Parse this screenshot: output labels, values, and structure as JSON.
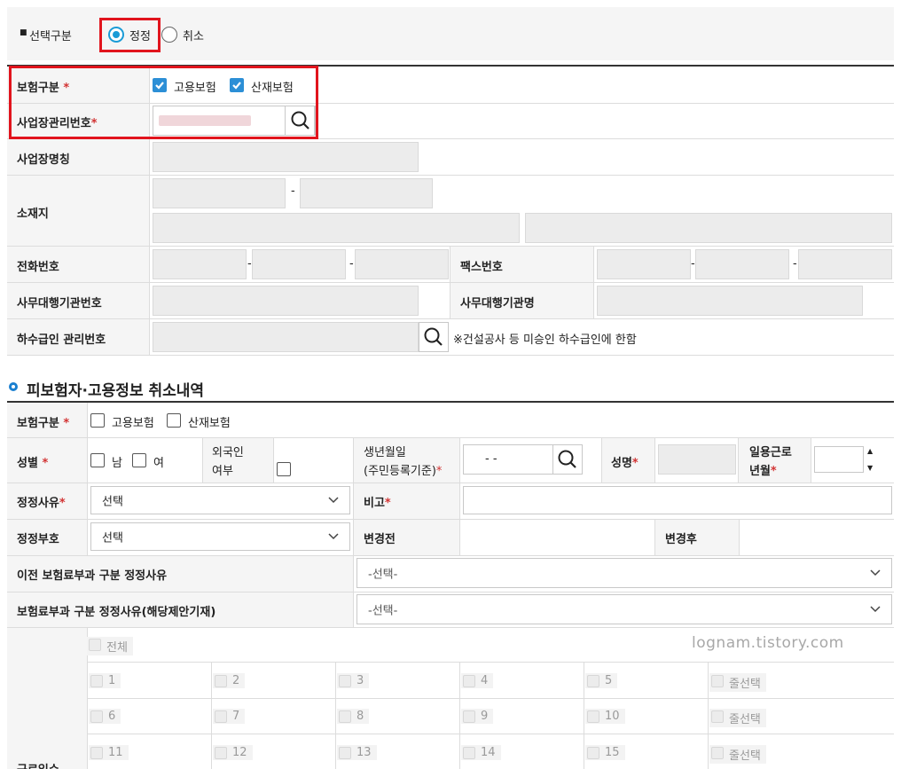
{
  "top": {
    "select_label": "선택구분",
    "radio_correct": "정정",
    "radio_cancel": "취소"
  },
  "section1": {
    "insurance_type_label": "보험구분",
    "employment_insurance": "고용보험",
    "industrial_insurance": "산재보험",
    "workplace_no_label": "사업장관리번호",
    "workplace_name_label": "사업장명칭",
    "location_label": "소재지",
    "phone_label": "전화번호",
    "fax_label": "팩스번호",
    "agency_no_label": "사무대행기관번호",
    "agency_name_label": "사무대행기관명",
    "sub_no_label": "하수급인 관리번호",
    "sub_note": "※건설공사 등 미승인 하수급인에 한함",
    "dash": "-"
  },
  "section2": {
    "title": "피보험자·고용정보 취소내역",
    "insurance_type_label": "보험구분",
    "employment_insurance": "고용보험",
    "industrial_insurance": "산재보험",
    "gender_label": "성별",
    "male": "남",
    "female": "여",
    "foreigner_label_1": "외국인",
    "foreigner_label_2": "여부",
    "birth_label_1": "생년월일",
    "birth_label_2": "(주민등록기준)",
    "birth_value": "- -",
    "name_label": "성명",
    "dayjob_label_1": "일용근로",
    "dayjob_label_2": "년월",
    "reason_label": "정정사유",
    "reason_value": "선택",
    "note_label": "비고",
    "code_label": "정정부호",
    "code_value": "선택",
    "before_label": "변경전",
    "after_label": "변경후",
    "prev_reason_label": "이전 보험료부과 구분 정정사유",
    "prev_reason_value": "-선택-",
    "reason2_label": "보험료부과 구분 정정사유(해당제안기재)",
    "reason2_value": "-선택-",
    "days_label": "근로일수",
    "all_label": "전체",
    "row_select": "줄선택",
    "days": [
      "1",
      "2",
      "3",
      "4",
      "5",
      "6",
      "7",
      "8",
      "9",
      "10",
      "11",
      "12",
      "13",
      "14",
      "15"
    ]
  },
  "watermark": "lognam.tistory.com",
  "colors": {
    "accent": "#1a9bd6",
    "checkbox_on": "#2c8fd6",
    "highlight": "#e1141d",
    "required": "#d23333"
  }
}
